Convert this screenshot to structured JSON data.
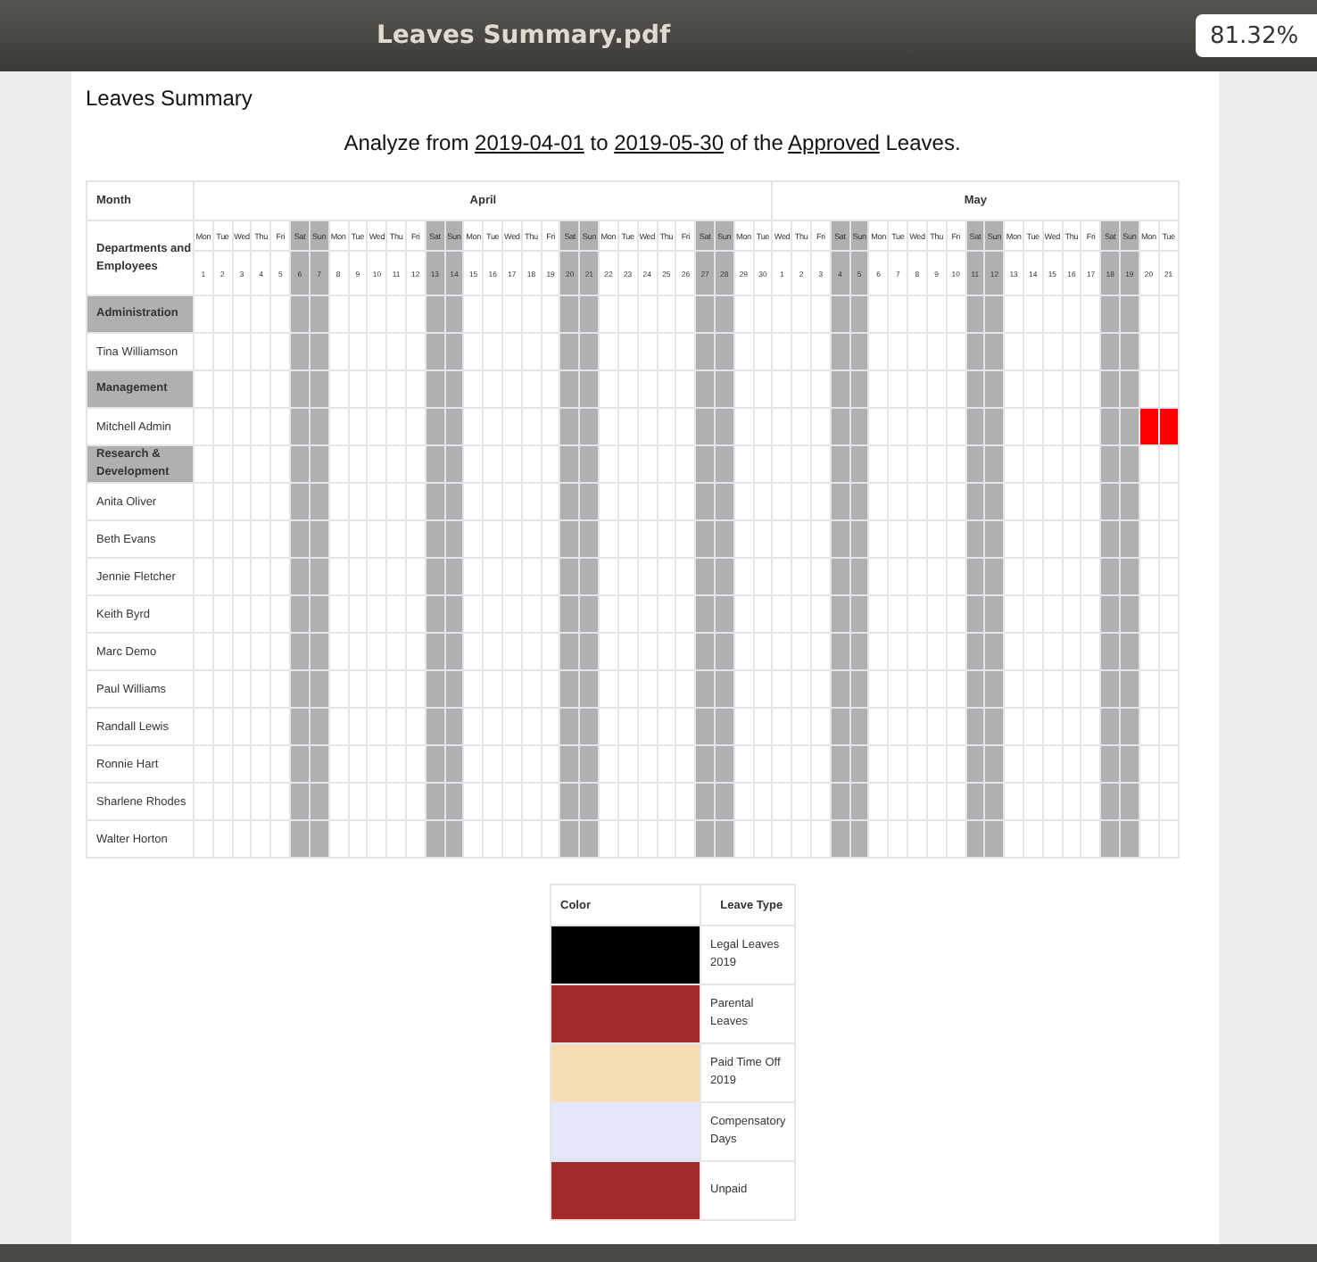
{
  "window": {
    "title": "Leaves Summary.pdf",
    "zoom": "81.32%"
  },
  "document": {
    "heading": "Leaves Summary",
    "subtitle_parts": [
      {
        "text": "Analyze from ",
        "underlined": false
      },
      {
        "text": "2019-04-01",
        "underlined": true
      },
      {
        "text": " to ",
        "underlined": false
      },
      {
        "text": "2019-05-30",
        "underlined": true
      },
      {
        "text": " of the ",
        "underlined": false
      },
      {
        "text": "Approved",
        "underlined": true
      },
      {
        "text": " Leaves.",
        "underlined": false
      }
    ]
  },
  "table": {
    "month_header": "Month",
    "row_header": "Departments and Employees",
    "months": [
      {
        "name": "April",
        "days": [
          {
            "weekday": "Mon",
            "day": "1",
            "weekend": false
          },
          {
            "weekday": "Tue",
            "day": "2",
            "weekend": false
          },
          {
            "weekday": "Wed",
            "day": "3",
            "weekend": false
          },
          {
            "weekday": "Thu",
            "day": "4",
            "weekend": false
          },
          {
            "weekday": "Fri",
            "day": "5",
            "weekend": false
          },
          {
            "weekday": "Sat",
            "day": "6",
            "weekend": true
          },
          {
            "weekday": "Sun",
            "day": "7",
            "weekend": true
          },
          {
            "weekday": "Mon",
            "day": "8",
            "weekend": false
          },
          {
            "weekday": "Tue",
            "day": "9",
            "weekend": false
          },
          {
            "weekday": "Wed",
            "day": "10",
            "weekend": false
          },
          {
            "weekday": "Thu",
            "day": "11",
            "weekend": false
          },
          {
            "weekday": "Fri",
            "day": "12",
            "weekend": false
          },
          {
            "weekday": "Sat",
            "day": "13",
            "weekend": true
          },
          {
            "weekday": "Sun",
            "day": "14",
            "weekend": true
          },
          {
            "weekday": "Mon",
            "day": "15",
            "weekend": false
          },
          {
            "weekday": "Tue",
            "day": "16",
            "weekend": false
          },
          {
            "weekday": "Wed",
            "day": "17",
            "weekend": false
          },
          {
            "weekday": "Thu",
            "day": "18",
            "weekend": false
          },
          {
            "weekday": "Fri",
            "day": "19",
            "weekend": false
          },
          {
            "weekday": "Sat",
            "day": "20",
            "weekend": true
          },
          {
            "weekday": "Sun",
            "day": "21",
            "weekend": true
          },
          {
            "weekday": "Mon",
            "day": "22",
            "weekend": false
          },
          {
            "weekday": "Tue",
            "day": "23",
            "weekend": false
          },
          {
            "weekday": "Wed",
            "day": "24",
            "weekend": false
          },
          {
            "weekday": "Thu",
            "day": "25",
            "weekend": false
          },
          {
            "weekday": "Fri",
            "day": "26",
            "weekend": false
          },
          {
            "weekday": "Sat",
            "day": "27",
            "weekend": true
          },
          {
            "weekday": "Sun",
            "day": "28",
            "weekend": true
          },
          {
            "weekday": "Mon",
            "day": "29",
            "weekend": false
          },
          {
            "weekday": "Tue",
            "day": "30",
            "weekend": false
          }
        ]
      },
      {
        "name": "May",
        "days": [
          {
            "weekday": "Wed",
            "day": "1",
            "weekend": false
          },
          {
            "weekday": "Thu",
            "day": "2",
            "weekend": false
          },
          {
            "weekday": "Fri",
            "day": "3",
            "weekend": false
          },
          {
            "weekday": "Sat",
            "day": "4",
            "weekend": true
          },
          {
            "weekday": "Sun",
            "day": "5",
            "weekend": true
          },
          {
            "weekday": "Mon",
            "day": "6",
            "weekend": false
          },
          {
            "weekday": "Tue",
            "day": "7",
            "weekend": false
          },
          {
            "weekday": "Wed",
            "day": "8",
            "weekend": false
          },
          {
            "weekday": "Thu",
            "day": "9",
            "weekend": false
          },
          {
            "weekday": "Fri",
            "day": "10",
            "weekend": false
          },
          {
            "weekday": "Sat",
            "day": "11",
            "weekend": true
          },
          {
            "weekday": "Sun",
            "day": "12",
            "weekend": true
          },
          {
            "weekday": "Mon",
            "day": "13",
            "weekend": false
          },
          {
            "weekday": "Tue",
            "day": "14",
            "weekend": false
          },
          {
            "weekday": "Wed",
            "day": "15",
            "weekend": false
          },
          {
            "weekday": "Thu",
            "day": "16",
            "weekend": false
          },
          {
            "weekday": "Fri",
            "day": "17",
            "weekend": false
          },
          {
            "weekday": "Sat",
            "day": "18",
            "weekend": true
          },
          {
            "weekday": "Sun",
            "day": "19",
            "weekend": true
          },
          {
            "weekday": "Mon",
            "day": "20",
            "weekend": false
          },
          {
            "weekday": "Tue",
            "day": "21",
            "weekend": false
          }
        ]
      }
    ],
    "rows": [
      {
        "kind": "department",
        "name": "Administration"
      },
      {
        "kind": "employee",
        "name": "Tina Williamson"
      },
      {
        "kind": "department",
        "name": "Management"
      },
      {
        "kind": "employee",
        "name": "Mitchell Admin",
        "cells": [
          {
            "leave": false
          },
          {
            "leave": false
          },
          {
            "leave": false
          },
          {
            "leave": false
          },
          {
            "leave": false
          },
          {
            "leave": false
          },
          {
            "leave": false
          },
          {
            "leave": false
          },
          {
            "leave": false
          },
          {
            "leave": false
          },
          {
            "leave": false
          },
          {
            "leave": false
          },
          {
            "leave": false
          },
          {
            "leave": false
          },
          {
            "leave": false
          },
          {
            "leave": false
          },
          {
            "leave": false
          },
          {
            "leave": false
          },
          {
            "leave": false
          },
          {
            "leave": false
          },
          {
            "leave": false
          },
          {
            "leave": false
          },
          {
            "leave": false
          },
          {
            "leave": false
          },
          {
            "leave": false
          },
          {
            "leave": false
          },
          {
            "leave": false
          },
          {
            "leave": false
          },
          {
            "leave": false
          },
          {
            "leave": false
          },
          {
            "leave": false
          },
          {
            "leave": false
          },
          {
            "leave": false
          },
          {
            "leave": false
          },
          {
            "leave": false
          },
          {
            "leave": false
          },
          {
            "leave": false
          },
          {
            "leave": false
          },
          {
            "leave": false
          },
          {
            "leave": false
          },
          {
            "leave": false
          },
          {
            "leave": false
          },
          {
            "leave": false
          },
          {
            "leave": false
          },
          {
            "leave": false
          },
          {
            "leave": false
          },
          {
            "leave": false
          },
          {
            "leave": false
          },
          {
            "leave": false
          },
          {
            "leave": true,
            "color": "#ff0000"
          },
          {
            "leave": true,
            "color": "#ff0000"
          }
        ]
      },
      {
        "kind": "department",
        "name": "Research & Development"
      },
      {
        "kind": "employee",
        "name": "Anita Oliver"
      },
      {
        "kind": "employee",
        "name": "Beth Evans"
      },
      {
        "kind": "employee",
        "name": "Jennie Fletcher"
      },
      {
        "kind": "employee",
        "name": "Keith Byrd"
      },
      {
        "kind": "employee",
        "name": "Marc Demo"
      },
      {
        "kind": "employee",
        "name": "Paul Williams"
      },
      {
        "kind": "employee",
        "name": "Randall Lewis"
      },
      {
        "kind": "employee",
        "name": "Ronnie Hart"
      },
      {
        "kind": "employee",
        "name": "Sharlene Rhodes"
      },
      {
        "kind": "employee",
        "name": "Walter Horton"
      }
    ]
  },
  "legend": {
    "columns": [
      "Color",
      "Leave Type"
    ],
    "items": [
      {
        "color": "#000000",
        "name": "Legal Leaves 2019"
      },
      {
        "color": "#a52a2a",
        "name": "Parental Leaves"
      },
      {
        "color": "#f5deb3",
        "name": "Paid Time Off 2019"
      },
      {
        "color": "#e6e6fa",
        "name": "Compensatory Days"
      },
      {
        "color": "#a52a2a",
        "name": "Unpaid"
      }
    ]
  }
}
